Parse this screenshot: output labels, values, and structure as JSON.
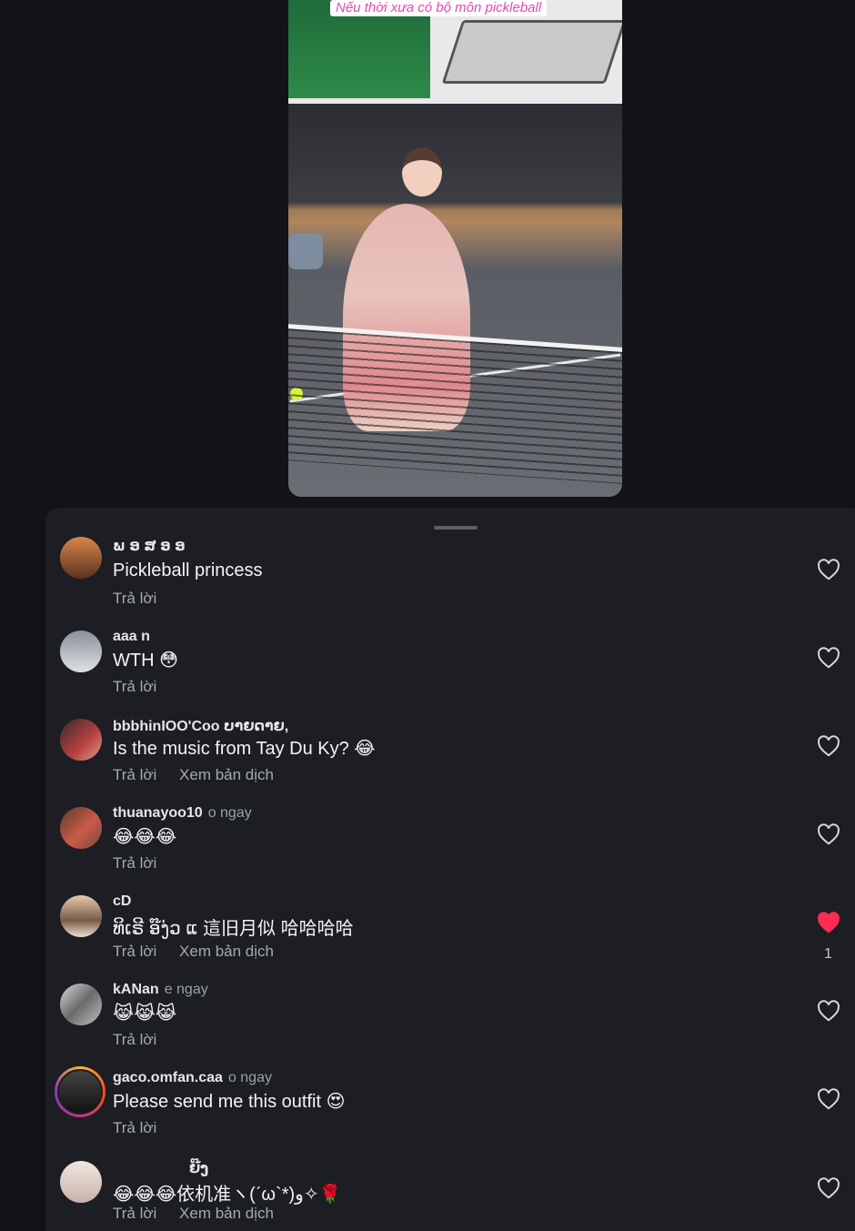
{
  "video": {
    "caption": "Nếu thời xưa có bộ môn pickleball"
  },
  "colors": {
    "background": "#111317",
    "sheet": "#1c1e23",
    "liked": "#fe2c55",
    "caption_text": "#e34bb0"
  },
  "comments": [
    {
      "username": "ພ ອ ສ ອ ອ",
      "age": "",
      "text": "Pickleball princess",
      "actions": [
        "Trả lời"
      ],
      "liked": false,
      "like_count": ""
    },
    {
      "username": "aaa n",
      "age": "",
      "text": "WTH 😳",
      "actions": [
        "Trả lời"
      ],
      "liked": false,
      "like_count": ""
    },
    {
      "username": "bbbhinIOO'Coo ບາຍດາຍ,",
      "age": "",
      "text": "Is the music from Tay Du Ky? 😂",
      "actions": [
        "Trả lời",
        "Xem bản dịch"
      ],
      "liked": false,
      "like_count": ""
    },
    {
      "username": "thuanayoo10",
      "age": "o ngay",
      "text": "😂😂😂",
      "actions": [
        "Trả lời"
      ],
      "liked": false,
      "like_count": ""
    },
    {
      "username": "cD",
      "age": "",
      "text": "ທິເຣີ ອ໊ງ່ວ ແ 這旧月似 哈哈哈哈",
      "actions": [
        "Trả lời",
        "Xem bản dịch"
      ],
      "liked": true,
      "like_count": "1"
    },
    {
      "username": "kANan",
      "age": "e ngay",
      "text": "😹😹😹",
      "actions": [
        "Trả lời"
      ],
      "liked": false,
      "like_count": ""
    },
    {
      "username": "gaco.omfan.caa",
      "age": "o ngay",
      "text": "Please send me this outfit 😍",
      "actions": [
        "Trả lời"
      ],
      "liked": false,
      "like_count": ""
    },
    {
      "username": "ຍ໊ງ",
      "age": "",
      "text": "😂😂😂依机准ヽ(ˊω`*)و✧🌹",
      "actions": [
        "Trả lời",
        "Xem bản dịch"
      ],
      "liked": false,
      "like_count": ""
    }
  ]
}
